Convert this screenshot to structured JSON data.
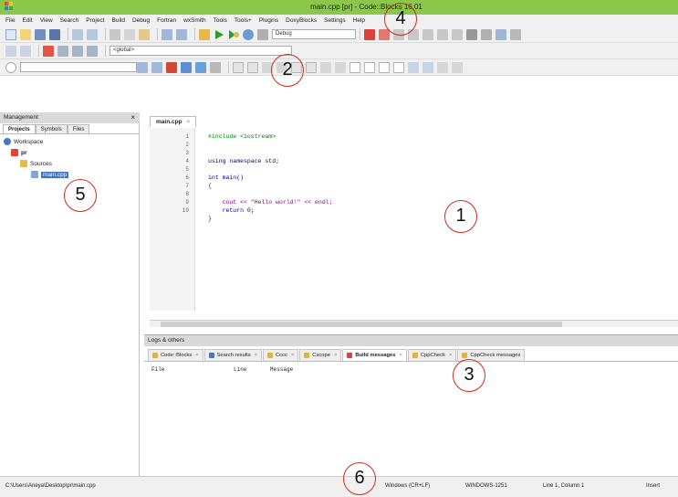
{
  "window": {
    "title": "main.cpp [pr] - Code::Blocks 16.01"
  },
  "menu": [
    "File",
    "Edit",
    "View",
    "Search",
    "Project",
    "Build",
    "Debug",
    "Fortran",
    "wxSmith",
    "Tools",
    "Tools+",
    "Plugins",
    "DoxyBlocks",
    "Settings",
    "Help"
  ],
  "toolbar": {
    "build_target": "Debug",
    "scope": "<global>"
  },
  "management": {
    "title": "Management",
    "close": "×",
    "tabs": [
      "Projects",
      "Symbols",
      "Files"
    ],
    "tree": {
      "workspace": "Workspace",
      "project": "pr",
      "sources": "Sources",
      "file": "main.cpp"
    }
  },
  "editor": {
    "tab": "main.cpp",
    "tab_close": "×",
    "line_numbers": [
      "1",
      "2",
      "3",
      "4",
      "5",
      "6",
      "7",
      "8",
      "9",
      "10"
    ],
    "code": [
      "#include <iostream>",
      "",
      "using namespace std;",
      "",
      "int main()",
      "{",
      "    cout << \"Hello world!\" << endl;",
      "    return 0;",
      "}",
      ""
    ]
  },
  "logs": {
    "title": "Logs & others",
    "tabs": [
      {
        "label": "Code::Blocks",
        "icon": "doc-icon",
        "color": "#e2b33c"
      },
      {
        "label": "Search results",
        "icon": "search-icon",
        "color": "#4a78c0"
      },
      {
        "label": "Cccc",
        "icon": "doc-icon",
        "color": "#e2b33c"
      },
      {
        "label": "Cscope",
        "icon": "doc-icon",
        "color": "#e2b33c"
      },
      {
        "label": "Build messages",
        "icon": "build-icon",
        "color": "#d8443a"
      },
      {
        "label": "CppCheck",
        "icon": "doc-icon",
        "color": "#e2b33c"
      },
      {
        "label": "CppCheck messages",
        "icon": "doc-icon",
        "color": "#e2b33c"
      }
    ],
    "columns": [
      "File",
      "Line",
      "Message"
    ]
  },
  "status": {
    "path": "C:\\Users\\Aneya\\Desktop\\pr\\main.cpp",
    "eol": "Windows (CR+LF)",
    "encoding": "WINDOWS-1251",
    "position": "Line 1, Column 1",
    "mode": "Insert"
  },
  "callouts": [
    "1",
    "2",
    "3",
    "4",
    "5",
    "6"
  ],
  "colors": {
    "titlebar": "#8ac74a",
    "callout": "#d42a1c",
    "keyword": "#00007f",
    "string": "#7f007f",
    "preproc": "#007f00"
  }
}
